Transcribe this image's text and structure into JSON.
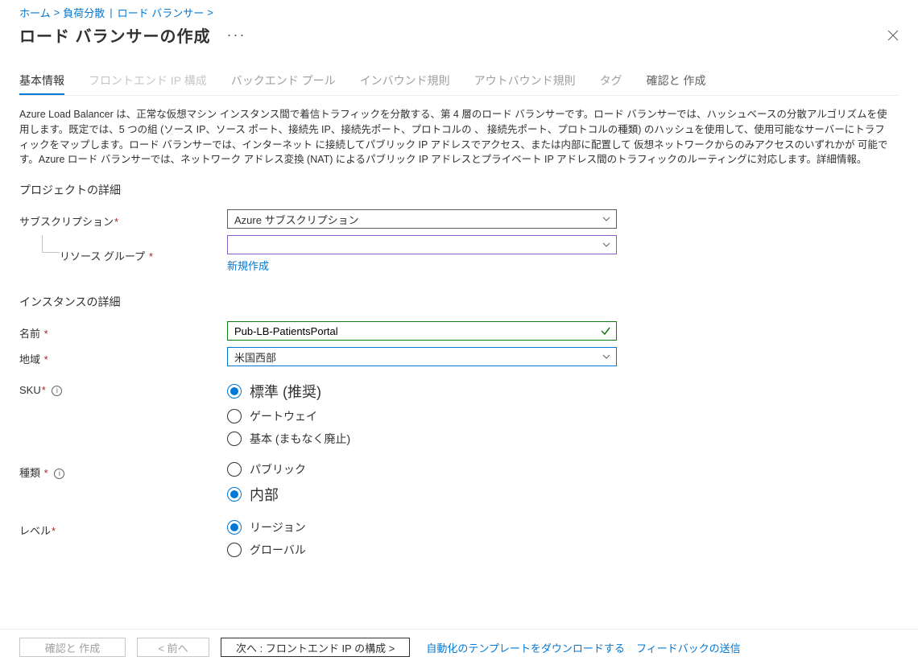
{
  "breadcrumb": {
    "home": "ホーム",
    "lb_service": "負荷分散",
    "lb_list": "ロード バランサー"
  },
  "title": "ロード バランサーの作成",
  "tabs": [
    {
      "label": "基本情報"
    },
    {
      "label": "フロントエンド IP 構成"
    },
    {
      "label": "バックエンド プール"
    },
    {
      "label": "インバウンド規則"
    },
    {
      "label": "アウトバウンド規則"
    },
    {
      "label": "タグ"
    },
    {
      "label": "確認と 作成"
    }
  ],
  "description": "Azure Load Balancer は、正常な仮想マシン インスタンス間で着信トラフィックを分散する、第 4 層のロード バランサーです。ロード バランサーでは、ハッシュベースの分散アルゴリズムを使用します。既定では、5 つの組 (ソース IP、ソース ポート、接続先 IP、接続先ポート、プロトコルの     、      接続先ポート、プロトコルの種類) のハッシュを使用して、使用可能なサーバーにトラフィックをマップします。ロード バランサーでは、インターネット に接続してパブリック IP アドレスでアクセス、または内部に配置して 仮想ネットワークからのみアクセスのいずれかが 可能です。Azure ロード バランサーでは、ネットワーク アドレス変換 (NAT) によるパブリック IP アドレスとプライベート IP アドレス間のトラフィックのルーティングに対応します。詳細情報。",
  "sections": {
    "project": "プロジェクトの詳細",
    "instance": "インスタンスの詳細"
  },
  "labels": {
    "subscription": "サブスクリプション",
    "resource_group": "リソース グループ",
    "create_new": "新規作成",
    "name": "名前",
    "region": "地域",
    "sku": "SKU",
    "type": "種類",
    "tier": "レベル"
  },
  "values": {
    "subscription": "Azure サブスクリプション",
    "resource_group": "",
    "name": "Pub-LB-PatientsPortal",
    "region": "米国西部"
  },
  "sku_options": [
    {
      "label": "標準 (推奨)",
      "selected": true,
      "big": true
    },
    {
      "label": "ゲートウェイ",
      "selected": false
    },
    {
      "label": "基本 (まもなく廃止)",
      "selected": false
    }
  ],
  "type_options": [
    {
      "label": "パブリック",
      "selected": false
    },
    {
      "label": "内部",
      "selected": true,
      "big": true
    }
  ],
  "tier_options": [
    {
      "label": "リージョン",
      "selected": true
    },
    {
      "label": "グローバル",
      "selected": false
    }
  ],
  "footer": {
    "review": "確認と 作成",
    "prev": "< 前へ",
    "next": "次へ : フロントエンド IP の構成   >",
    "template_link": "自動化のテンプレートをダウンロードする",
    "feedback_link": "フィードバックの送信"
  }
}
